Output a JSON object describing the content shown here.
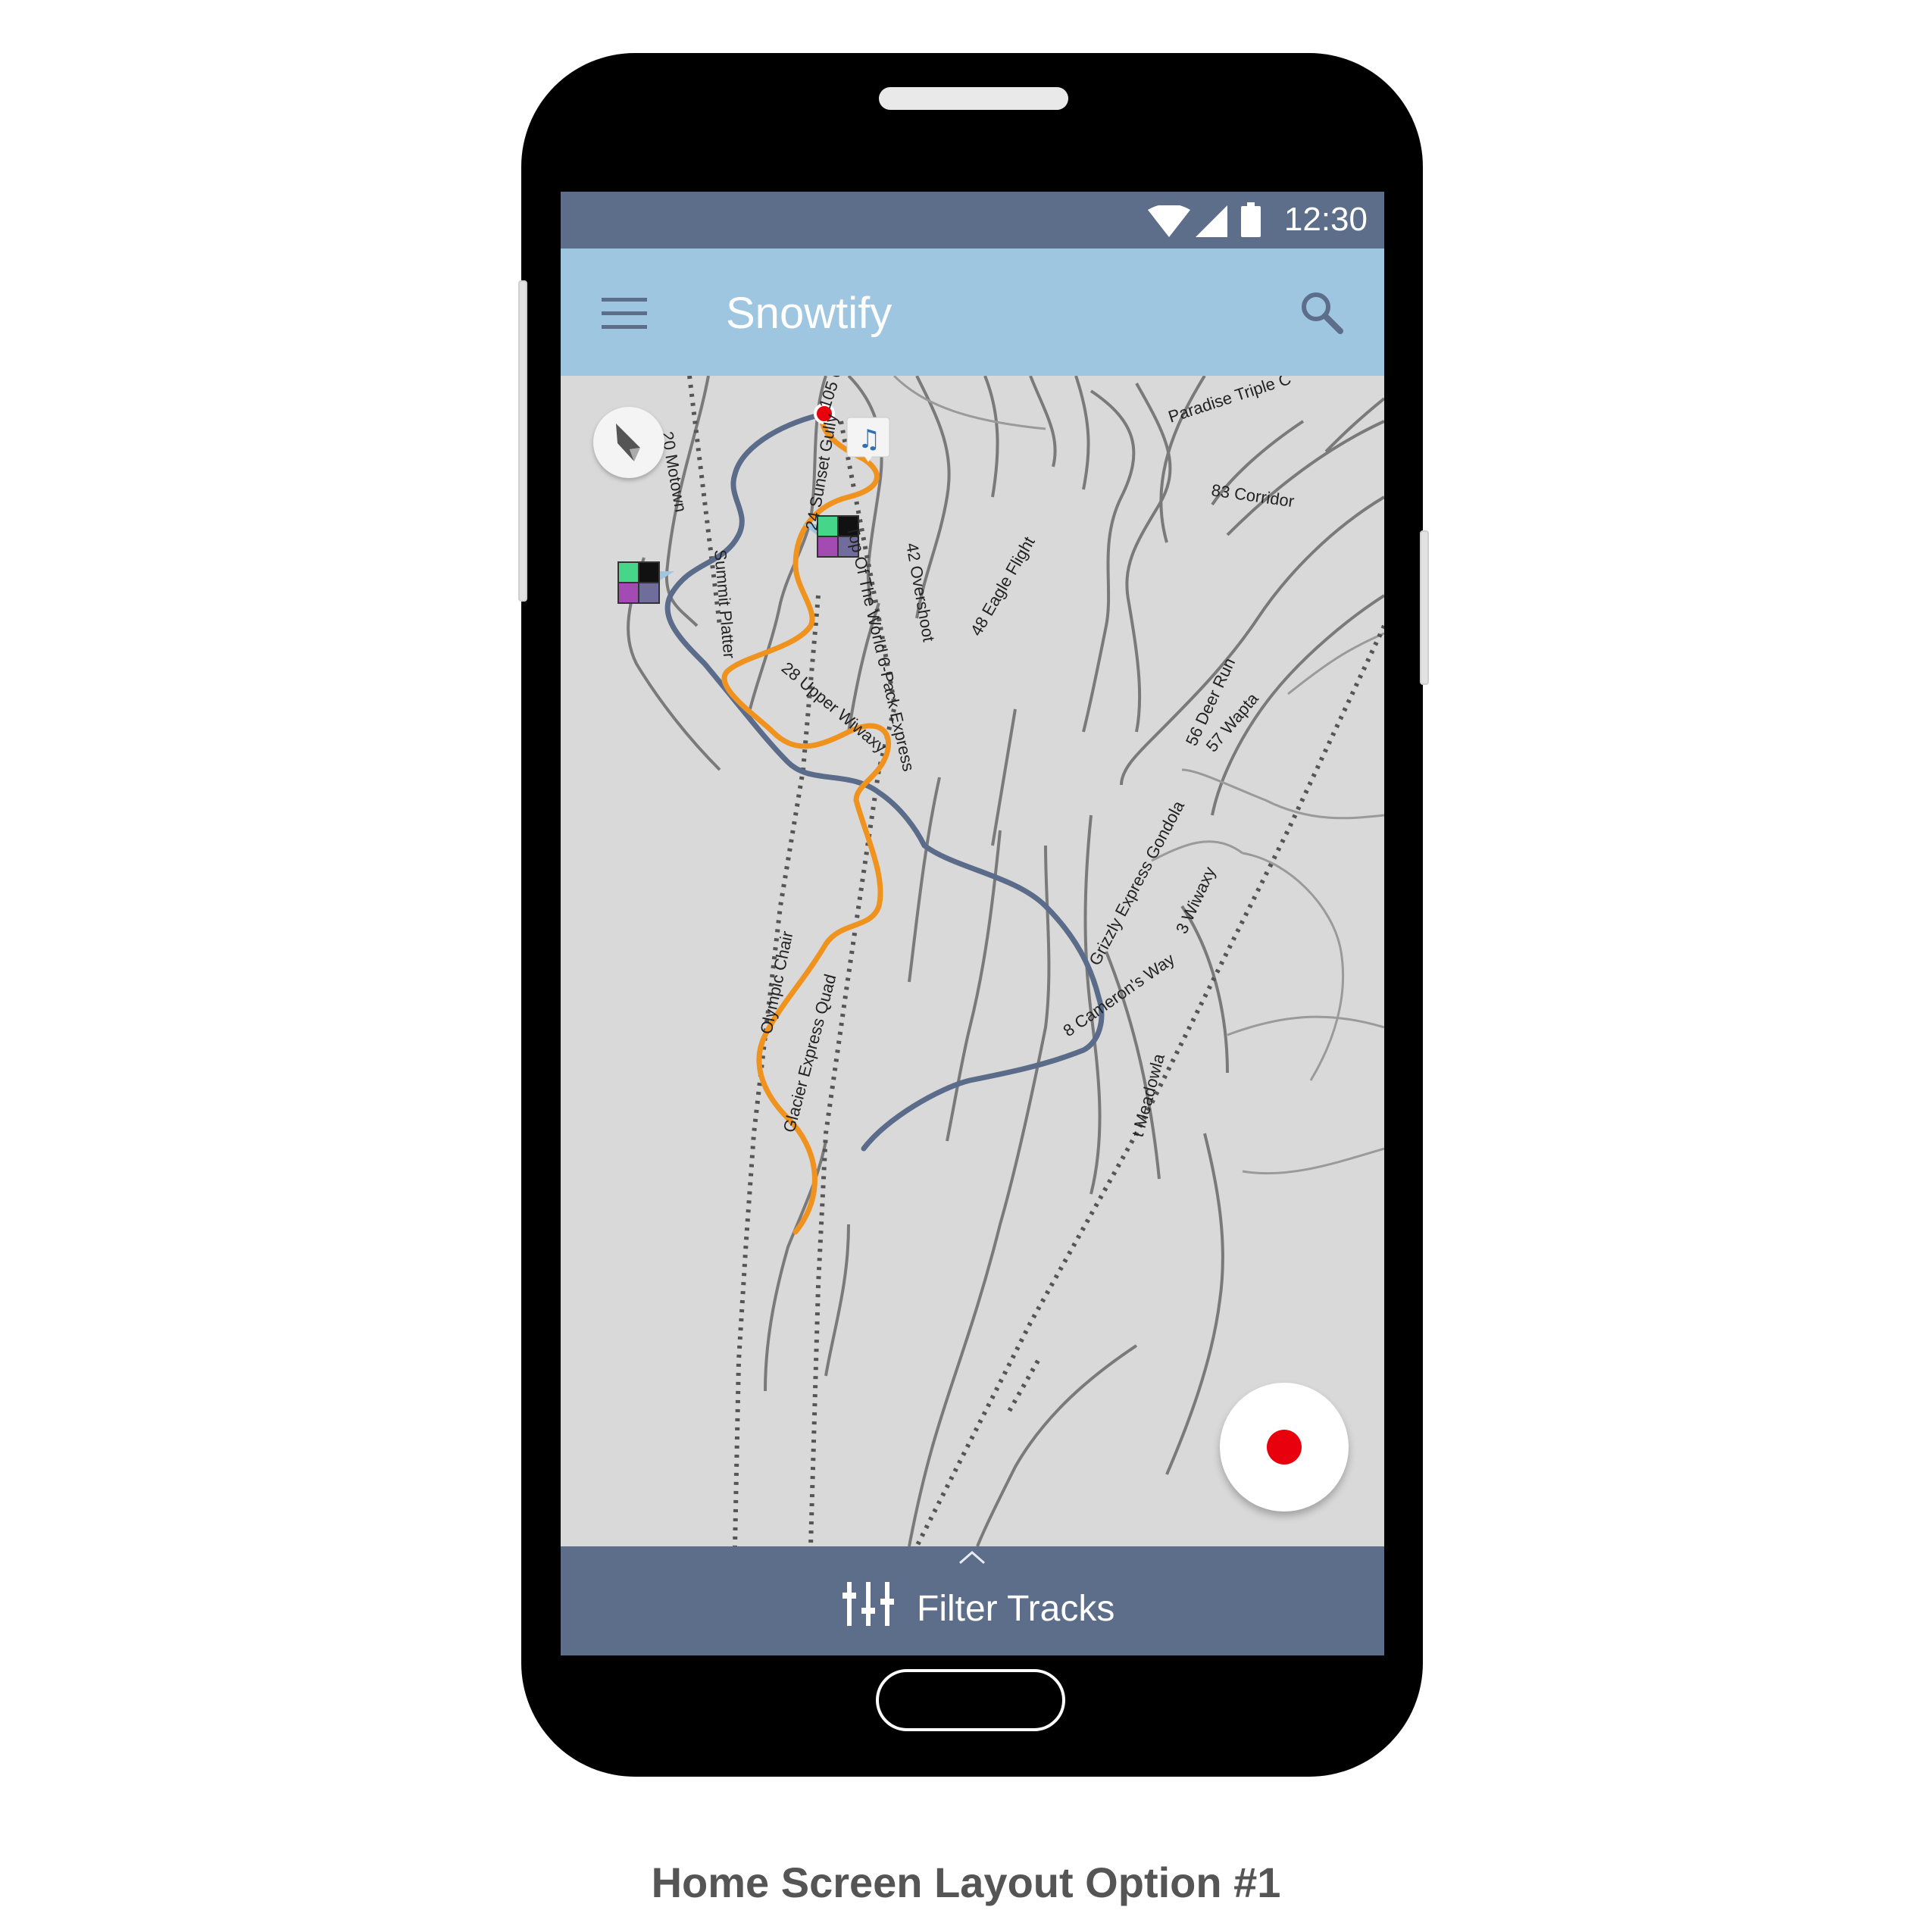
{
  "status_bar": {
    "time": "12:30",
    "icons": [
      "wifi-icon",
      "signal-icon",
      "battery-icon"
    ]
  },
  "app_bar": {
    "title": "Snowtify",
    "menu_icon": "menu-icon",
    "search_icon": "search-icon"
  },
  "map": {
    "trail_labels": [
      "105 C",
      "Paradise Triple C",
      "83 Corridor",
      "20 Motown",
      "24 Sunset Gully",
      "Top Of The World 6-Pack Express",
      "Summit Platter",
      "42 Overshoot",
      "48 Eagle Flight",
      "56 Deer Run",
      "57 Wapta",
      "28 Upper Wiwaxy",
      "Olympic Chair",
      "Glacier Express Quad",
      "Grizzly Express Gondola",
      "8 Cameron's Way",
      "3 Wiwaxy",
      "t Meadowla"
    ]
  },
  "record_button": {
    "icon": "record-icon"
  },
  "bottom_bar": {
    "label": "Filter Tracks",
    "icon": "sliders-icon",
    "expand_icon": "chevron-up-icon"
  },
  "caption": "Home Screen Layout Option #1",
  "colors": {
    "status": "#5d6e8b",
    "appbar": "#9ec6e0",
    "orange_track": "#f0921e",
    "blue_track": "#5b6c8a",
    "record": "#e8000c"
  }
}
